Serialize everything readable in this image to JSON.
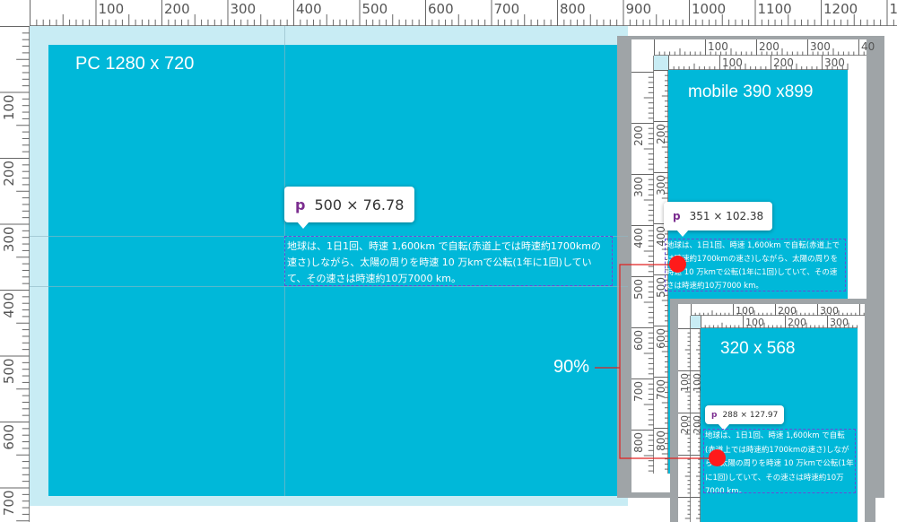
{
  "colors": {
    "device": "#00b8d9",
    "gutter": "#c8ecf4",
    "ruler_bg": "#ffffff",
    "tick": "#555555",
    "frame": "#9fa4a7",
    "accent": "#e02020",
    "tag": "#7b2d8f"
  },
  "pc": {
    "label": "PC 1280 x 720",
    "tooltip": {
      "tag": "p",
      "size": "500 × 76.78"
    },
    "paragraph": "地球は、1日1回、時速 1,600km で自転(赤道上では時速約1700kmの速さ)しながら、太陽の周りを時速 10 万kmで公転(1年に1回)していて、その速さは時速約10万7000 km。",
    "ruler_top_labels": [
      "100",
      "200",
      "300",
      "400",
      "500",
      "600",
      "700",
      "800",
      "900",
      "1000",
      "1100",
      "1200",
      "13"
    ],
    "ruler_inner_top_labels": [
      "100",
      "200",
      "300",
      "400",
      "500",
      "600",
      "700",
      "800"
    ],
    "ruler_left_labels": [
      "100",
      "200",
      "300",
      "400",
      "500",
      "600",
      "700"
    ],
    "ruler_inner_left_labels": [
      "100",
      "200",
      "300",
      "400",
      "500",
      "600",
      "700"
    ]
  },
  "mobile": {
    "label": "mobile 390 x899",
    "tooltip": {
      "tag": "p",
      "size": "351 × 102.38"
    },
    "paragraph": "地球は、1日1回、時速 1,600km で自転(赤道上では時速約1700kmの速さ)しながら、太陽の周りを時速 10 万kmで公転(1年に1回)していて、その速さは時速約10万7000 km。",
    "ruler_top_labels": [
      "100",
      "200",
      "300",
      "40"
    ],
    "ruler_inner_top_labels": [
      "100",
      "200",
      "300"
    ],
    "ruler_left_labels": [
      "200",
      "300",
      "400",
      "500",
      "600",
      "700",
      "800"
    ]
  },
  "small": {
    "label": "320 x 568",
    "tooltip": {
      "tag": "p",
      "size": "288 × 127.97"
    },
    "paragraph": "地球は、1日1回、時速 1,600km で自転(赤道上では時速約1700kmの速さ)しながら、太陽の周りを時速 10 万kmで公転(1年に1回)していて、その速さは時速約10万7000 km。",
    "ruler_top_labels": [
      "100",
      "200",
      "300"
    ],
    "ruler_inner_top_labels": [
      "100",
      "200",
      "300"
    ],
    "ruler_left_labels": [
      "100",
      "200"
    ]
  },
  "scale_label": "90%"
}
